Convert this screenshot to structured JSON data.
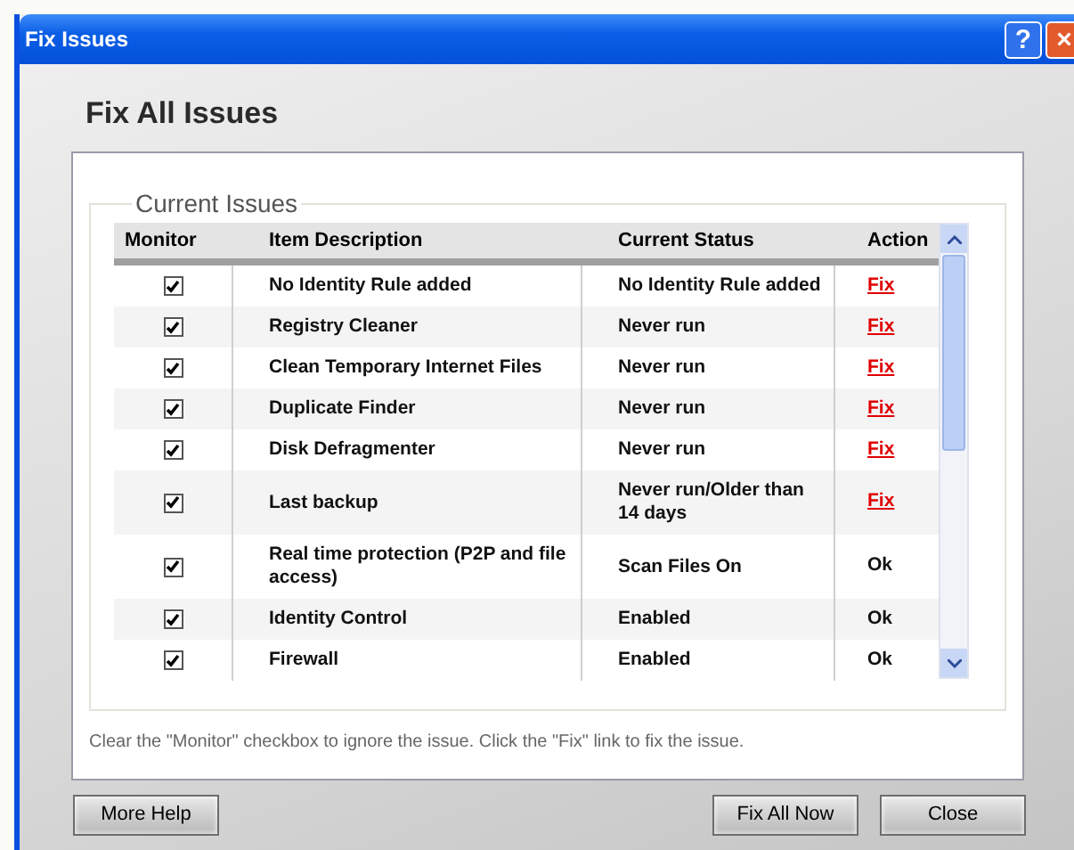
{
  "window": {
    "title": "Fix Issues",
    "controls": [
      "?",
      "×"
    ]
  },
  "heading": "Fix All Issues",
  "group_title": "Current Issues",
  "table": {
    "columns": [
      "Monitor",
      "Item Description",
      "Current Status",
      "Action"
    ],
    "rows": [
      {
        "checked": true,
        "description": "No Identity Rule added",
        "status": "No Identity Rule added",
        "action": {
          "kind": "link",
          "label": "Fix"
        }
      },
      {
        "checked": true,
        "description": "Registry Cleaner",
        "status": "Never run",
        "action": {
          "kind": "link",
          "label": "Fix"
        }
      },
      {
        "checked": true,
        "description": "Clean Temporary Internet Files",
        "status": "Never run",
        "action": {
          "kind": "link",
          "label": "Fix"
        }
      },
      {
        "checked": true,
        "description": "Duplicate Finder",
        "status": "Never run",
        "action": {
          "kind": "link",
          "label": "Fix"
        }
      },
      {
        "checked": true,
        "description": "Disk Defragmenter",
        "status": "Never run",
        "action": {
          "kind": "link",
          "label": "Fix"
        }
      },
      {
        "checked": true,
        "description": "Last backup",
        "status": "Never run/Older than 14 days",
        "action": {
          "kind": "link",
          "label": "Fix"
        }
      },
      {
        "checked": true,
        "description": "Real time protection (P2P and file access)",
        "status": "Scan Files On",
        "action": {
          "kind": "text",
          "label": "Ok"
        }
      },
      {
        "checked": true,
        "description": "Identity Control",
        "status": "Enabled",
        "action": {
          "kind": "text",
          "label": "Ok"
        }
      },
      {
        "checked": true,
        "description": "Firewall",
        "status": "Enabled",
        "action": {
          "kind": "text",
          "label": "Ok"
        }
      }
    ]
  },
  "hint": "Clear the \"Monitor\" checkbox to ignore the issue. Click the \"Fix\" link to fix the issue.",
  "buttons": {
    "left": [
      "More Help"
    ],
    "right": [
      "Fix All Now",
      "Close"
    ]
  }
}
